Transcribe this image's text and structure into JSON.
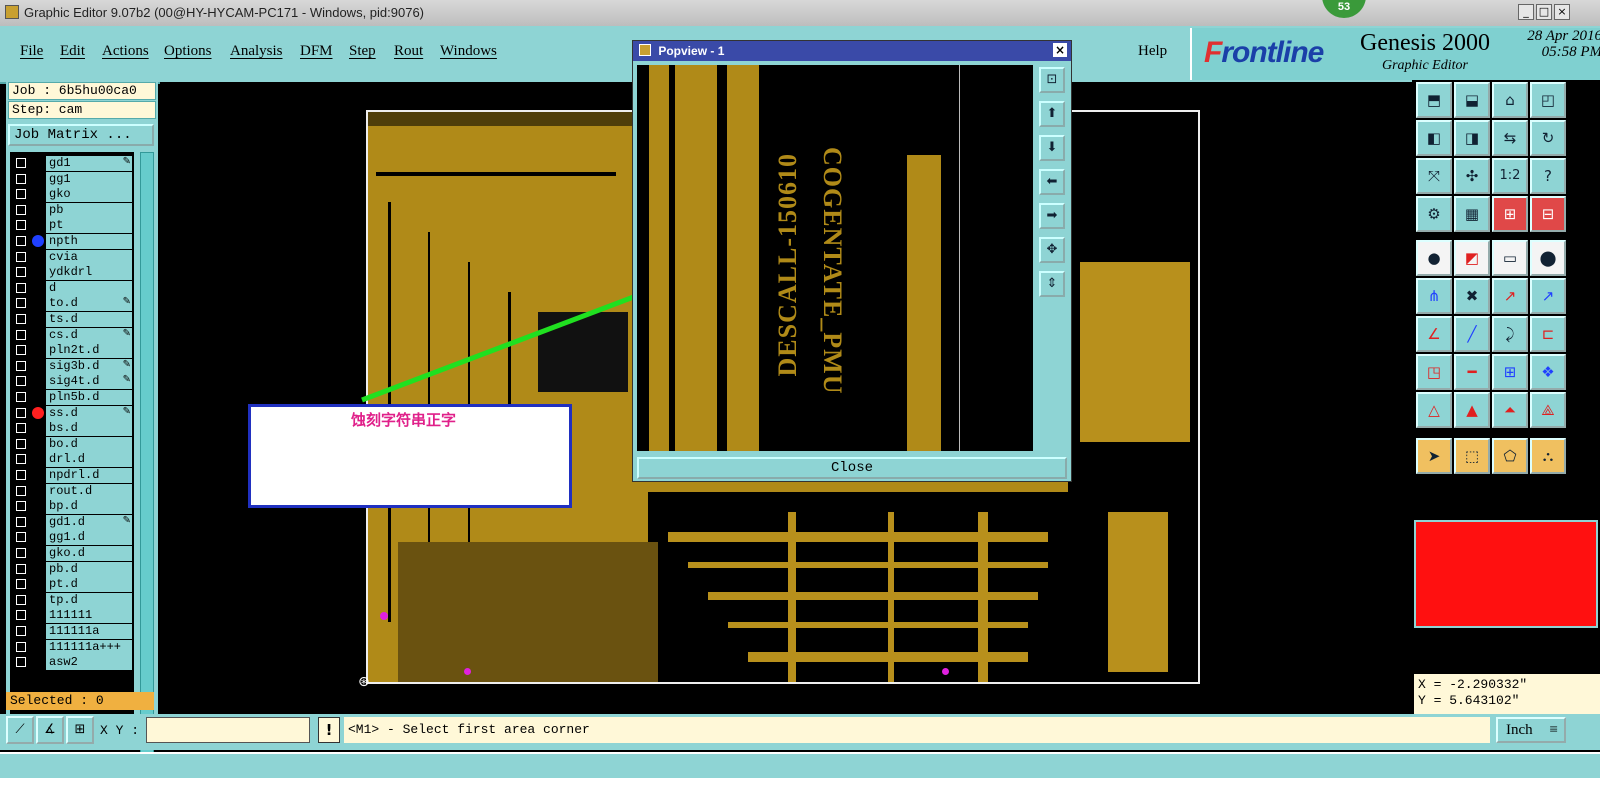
{
  "window": {
    "title": "Graphic Editor 9.07b2 (00@HY-HYCAM-PC171 - Windows, pid:9076)",
    "badge": "53"
  },
  "menu": {
    "items": [
      "File",
      "Edit",
      "Actions",
      "Options",
      "Analysis",
      "DFM",
      "Step",
      "Rout",
      "Windows"
    ],
    "help": "Help"
  },
  "brand": {
    "logo_f": "F",
    "logo_rest": "rontline",
    "product": "Genesis 2000",
    "subtitle": "Graphic Editor",
    "date": "28 Apr 2016",
    "time": "05:58 PM"
  },
  "left": {
    "job": "Job : 6b5hu00ca0",
    "step": "Step: cam",
    "job_matrix": "Job Matrix ...",
    "selected": "Selected : 0",
    "layers": [
      {
        "name": "gd1",
        "edit": true,
        "dot": ""
      },
      {
        "name": "gg1",
        "edit": false,
        "dot": ""
      },
      {
        "name": "gko",
        "edit": false,
        "dot": ""
      },
      {
        "name": "pb",
        "edit": false,
        "dot": ""
      },
      {
        "name": "pt",
        "edit": false,
        "dot": ""
      },
      {
        "name": "npth",
        "edit": false,
        "dot": "#2040ff"
      },
      {
        "name": "cvia",
        "edit": false,
        "dot": ""
      },
      {
        "name": "ydkdrl",
        "edit": false,
        "dot": ""
      },
      {
        "name": "d",
        "edit": false,
        "dot": ""
      },
      {
        "name": "to.d",
        "edit": true,
        "dot": ""
      },
      {
        "name": "ts.d",
        "edit": false,
        "dot": ""
      },
      {
        "name": "cs.d",
        "edit": true,
        "dot": ""
      },
      {
        "name": "pln2t.d",
        "edit": false,
        "dot": ""
      },
      {
        "name": "sig3b.d",
        "edit": true,
        "dot": ""
      },
      {
        "name": "sig4t.d",
        "edit": true,
        "dot": ""
      },
      {
        "name": "pln5b.d",
        "edit": false,
        "dot": ""
      },
      {
        "name": "ss.d",
        "edit": true,
        "dot": "#ff2020"
      },
      {
        "name": "bs.d",
        "edit": false,
        "dot": ""
      },
      {
        "name": "bo.d",
        "edit": false,
        "dot": ""
      },
      {
        "name": "drl.d",
        "edit": false,
        "dot": ""
      },
      {
        "name": "npdrl.d",
        "edit": false,
        "dot": ""
      },
      {
        "name": "rout.d",
        "edit": false,
        "dot": ""
      },
      {
        "name": "bp.d",
        "edit": false,
        "dot": ""
      },
      {
        "name": "gd1.d",
        "edit": true,
        "dot": ""
      },
      {
        "name": "gg1.d",
        "edit": false,
        "dot": ""
      },
      {
        "name": "gko.d",
        "edit": false,
        "dot": ""
      },
      {
        "name": "pb.d",
        "edit": false,
        "dot": ""
      },
      {
        "name": "pt.d",
        "edit": false,
        "dot": ""
      },
      {
        "name": "tp.d",
        "edit": false,
        "dot": ""
      },
      {
        "name": "111111",
        "edit": false,
        "dot": ""
      },
      {
        "name": "111111a",
        "edit": false,
        "dot": ""
      },
      {
        "name": "111111a+++",
        "edit": false,
        "dot": ""
      },
      {
        "name": "asw2",
        "edit": false,
        "dot": ""
      }
    ]
  },
  "popup": {
    "title": "Popview - 1",
    "text1": "COGENTATE_PMU",
    "text2": "DESCALL-150610",
    "close": "Close"
  },
  "annotation": {
    "text": "蚀刻字符串正字"
  },
  "coords": {
    "x": "X = -2.290332\"",
    "y": "Y = 5.643102\""
  },
  "bottom": {
    "xy_label": "X Y :",
    "xy_value": "",
    "excl": "!",
    "prompt": "<M1> - Select first area corner",
    "unit": "Inch"
  },
  "colors": {
    "copper": "#b08a18",
    "panel": "#8ed4d4",
    "swatch": "#ff1010",
    "arrow": "#20e020"
  }
}
